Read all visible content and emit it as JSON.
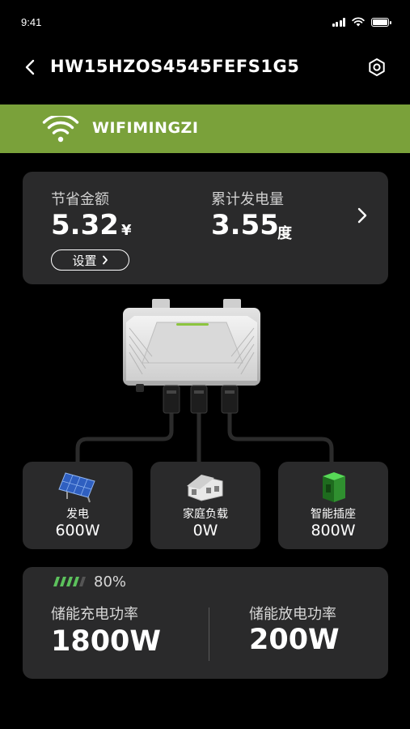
{
  "status_bar": {
    "time": "9:41"
  },
  "nav": {
    "title": "HW15HZOS4545FEFS1G5"
  },
  "wifi": {
    "name": "WIFIMINGZI"
  },
  "summary": {
    "savings_label": "节省金额",
    "savings_value": "5.32",
    "savings_unit": "¥",
    "generation_label": "累计发电量",
    "generation_value": "3.55",
    "generation_unit": "度",
    "settings_label": "设置"
  },
  "tiles": [
    {
      "label": "发电",
      "value": "600W",
      "icon": "solar-panel-icon"
    },
    {
      "label": "家庭负载",
      "value": "0W",
      "icon": "house-icon"
    },
    {
      "label": "智能插座",
      "value": "800W",
      "icon": "smart-plug-icon"
    }
  ],
  "storage": {
    "battery_percent": "80%",
    "battery_level": 0.8,
    "charge_label": "储能充电功率",
    "charge_value": "1800W",
    "discharge_label": "储能放电功率",
    "discharge_value": "200W"
  },
  "colors": {
    "background": "#000000",
    "banner": "#7aa13a",
    "card": "#2a2a2b",
    "battery_green": "#5cc15c"
  }
}
